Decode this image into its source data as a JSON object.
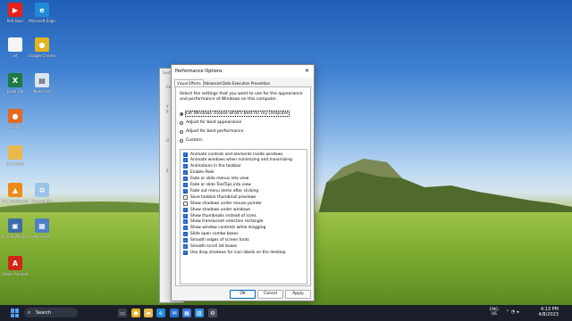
{
  "desktop": {
    "icons": [
      {
        "label": "Red Hour",
        "icon": "youtube-icon",
        "color": "#e62117",
        "glyph": "▶"
      },
      {
        "label": "Microsoft Edge",
        "icon": "edge-icon",
        "color": "#1f8ad6",
        "glyph": "e"
      },
      {
        "label": "wf",
        "icon": "file-icon",
        "color": "#f5f5f5",
        "glyph": ""
      },
      {
        "label": "Google Chrome",
        "icon": "chrome-icon",
        "color": "#e3b422",
        "glyph": "●"
      },
      {
        "label": "Excel File",
        "icon": "excel-icon",
        "color": "#1d7a45",
        "glyph": "X"
      },
      {
        "label": "New Card",
        "icon": "card-file-icon",
        "color": "#dbe6f2",
        "glyph": "▤"
      },
      {
        "label": "Firefox",
        "icon": "firefox-icon",
        "color": "#e46a1f",
        "glyph": "●"
      },
      {
        "label": "Bootstrap",
        "icon": "folder-icon",
        "color": "#e8b84a",
        "glyph": ""
      },
      {
        "label": "VLC media player",
        "icon": "vlc-icon",
        "color": "#f08a15",
        "glyph": "▲"
      },
      {
        "label": "Recycle Bin",
        "icon": "recycle-bin-icon",
        "color": "#9cc3e8",
        "glyph": "♻"
      },
      {
        "label": "Oracle VM VirtualBox",
        "icon": "virtualbox-icon",
        "color": "#3b6ea8",
        "glyph": "▣"
      },
      {
        "label": "My Folder",
        "icon": "folder-icon",
        "color": "#4f7fc5",
        "glyph": "▦"
      },
      {
        "label": "Adobe Acrobat",
        "icon": "acrobat-icon",
        "color": "#d32418",
        "glyph": "A"
      }
    ]
  },
  "bg_dialog": {
    "title": "Syst",
    "side_letters": [
      "Co",
      "Y",
      "P",
      "U",
      "S"
    ]
  },
  "dialog": {
    "title": "Performance Options",
    "close_glyph": "✕",
    "tabs": [
      "Visual Effects",
      "Advanced",
      "Data Execution Prevention"
    ],
    "active_tab": 0,
    "description": "Select the settings that you want to use for the appearance and performance of Windows on this computer.",
    "radios": [
      {
        "label": "Let Windows choose what's best for my computer",
        "selected": true
      },
      {
        "label": "Adjust for best appearance",
        "selected": false
      },
      {
        "label": "Adjust for best performance",
        "selected": false
      },
      {
        "label": "Custom:",
        "selected": false
      }
    ],
    "options": [
      {
        "label": "Animate controls and elements inside windows",
        "checked": true
      },
      {
        "label": "Animate windows when minimizing and maximizing",
        "checked": true
      },
      {
        "label": "Animations in the taskbar",
        "checked": true
      },
      {
        "label": "Enable Peek",
        "checked": true
      },
      {
        "label": "Fade or slide menus into view",
        "checked": true
      },
      {
        "label": "Fade or slide ToolTips into view",
        "checked": true
      },
      {
        "label": "Fade out menu items after clicking",
        "checked": true
      },
      {
        "label": "Save taskbar thumbnail previews",
        "checked": false
      },
      {
        "label": "Show shadows under mouse pointer",
        "checked": false
      },
      {
        "label": "Show shadows under windows",
        "checked": true
      },
      {
        "label": "Show thumbnails instead of icons",
        "checked": true
      },
      {
        "label": "Show translucent selection rectangle",
        "checked": true
      },
      {
        "label": "Show window contents while dragging",
        "checked": true
      },
      {
        "label": "Slide open combo boxes",
        "checked": true
      },
      {
        "label": "Smooth edges of screen fonts",
        "checked": true
      },
      {
        "label": "Smooth-scroll list boxes",
        "checked": true
      },
      {
        "label": "Use drop shadows for icon labels on the desktop",
        "checked": true
      }
    ],
    "buttons": {
      "ok": "OK",
      "cancel": "Cancel",
      "apply": "Apply"
    }
  },
  "taskbar": {
    "search_placeholder": "Search",
    "apps": [
      {
        "icon": "task-view-icon",
        "color": "#3a3f4d",
        "glyph": "▭"
      },
      {
        "icon": "chrome-icon",
        "color": "#e3b422",
        "glyph": "●"
      },
      {
        "icon": "file-explorer-icon",
        "color": "#e8b84a",
        "glyph": "▬"
      },
      {
        "icon": "edge-icon",
        "color": "#1f8ad6",
        "glyph": "e"
      },
      {
        "icon": "mail-icon",
        "color": "#2a6fd0",
        "glyph": "✉"
      },
      {
        "icon": "store-icon",
        "color": "#3c78d8",
        "glyph": "▦"
      },
      {
        "icon": "photos-icon",
        "color": "#2f8fd8",
        "glyph": "▨"
      },
      {
        "icon": "settings-icon",
        "color": "#4a4f5e",
        "glyph": "⚙"
      }
    ],
    "lang_top": "ENG",
    "lang_bottom": "US",
    "time": "4:13 PM",
    "date": "4/8/2023"
  }
}
